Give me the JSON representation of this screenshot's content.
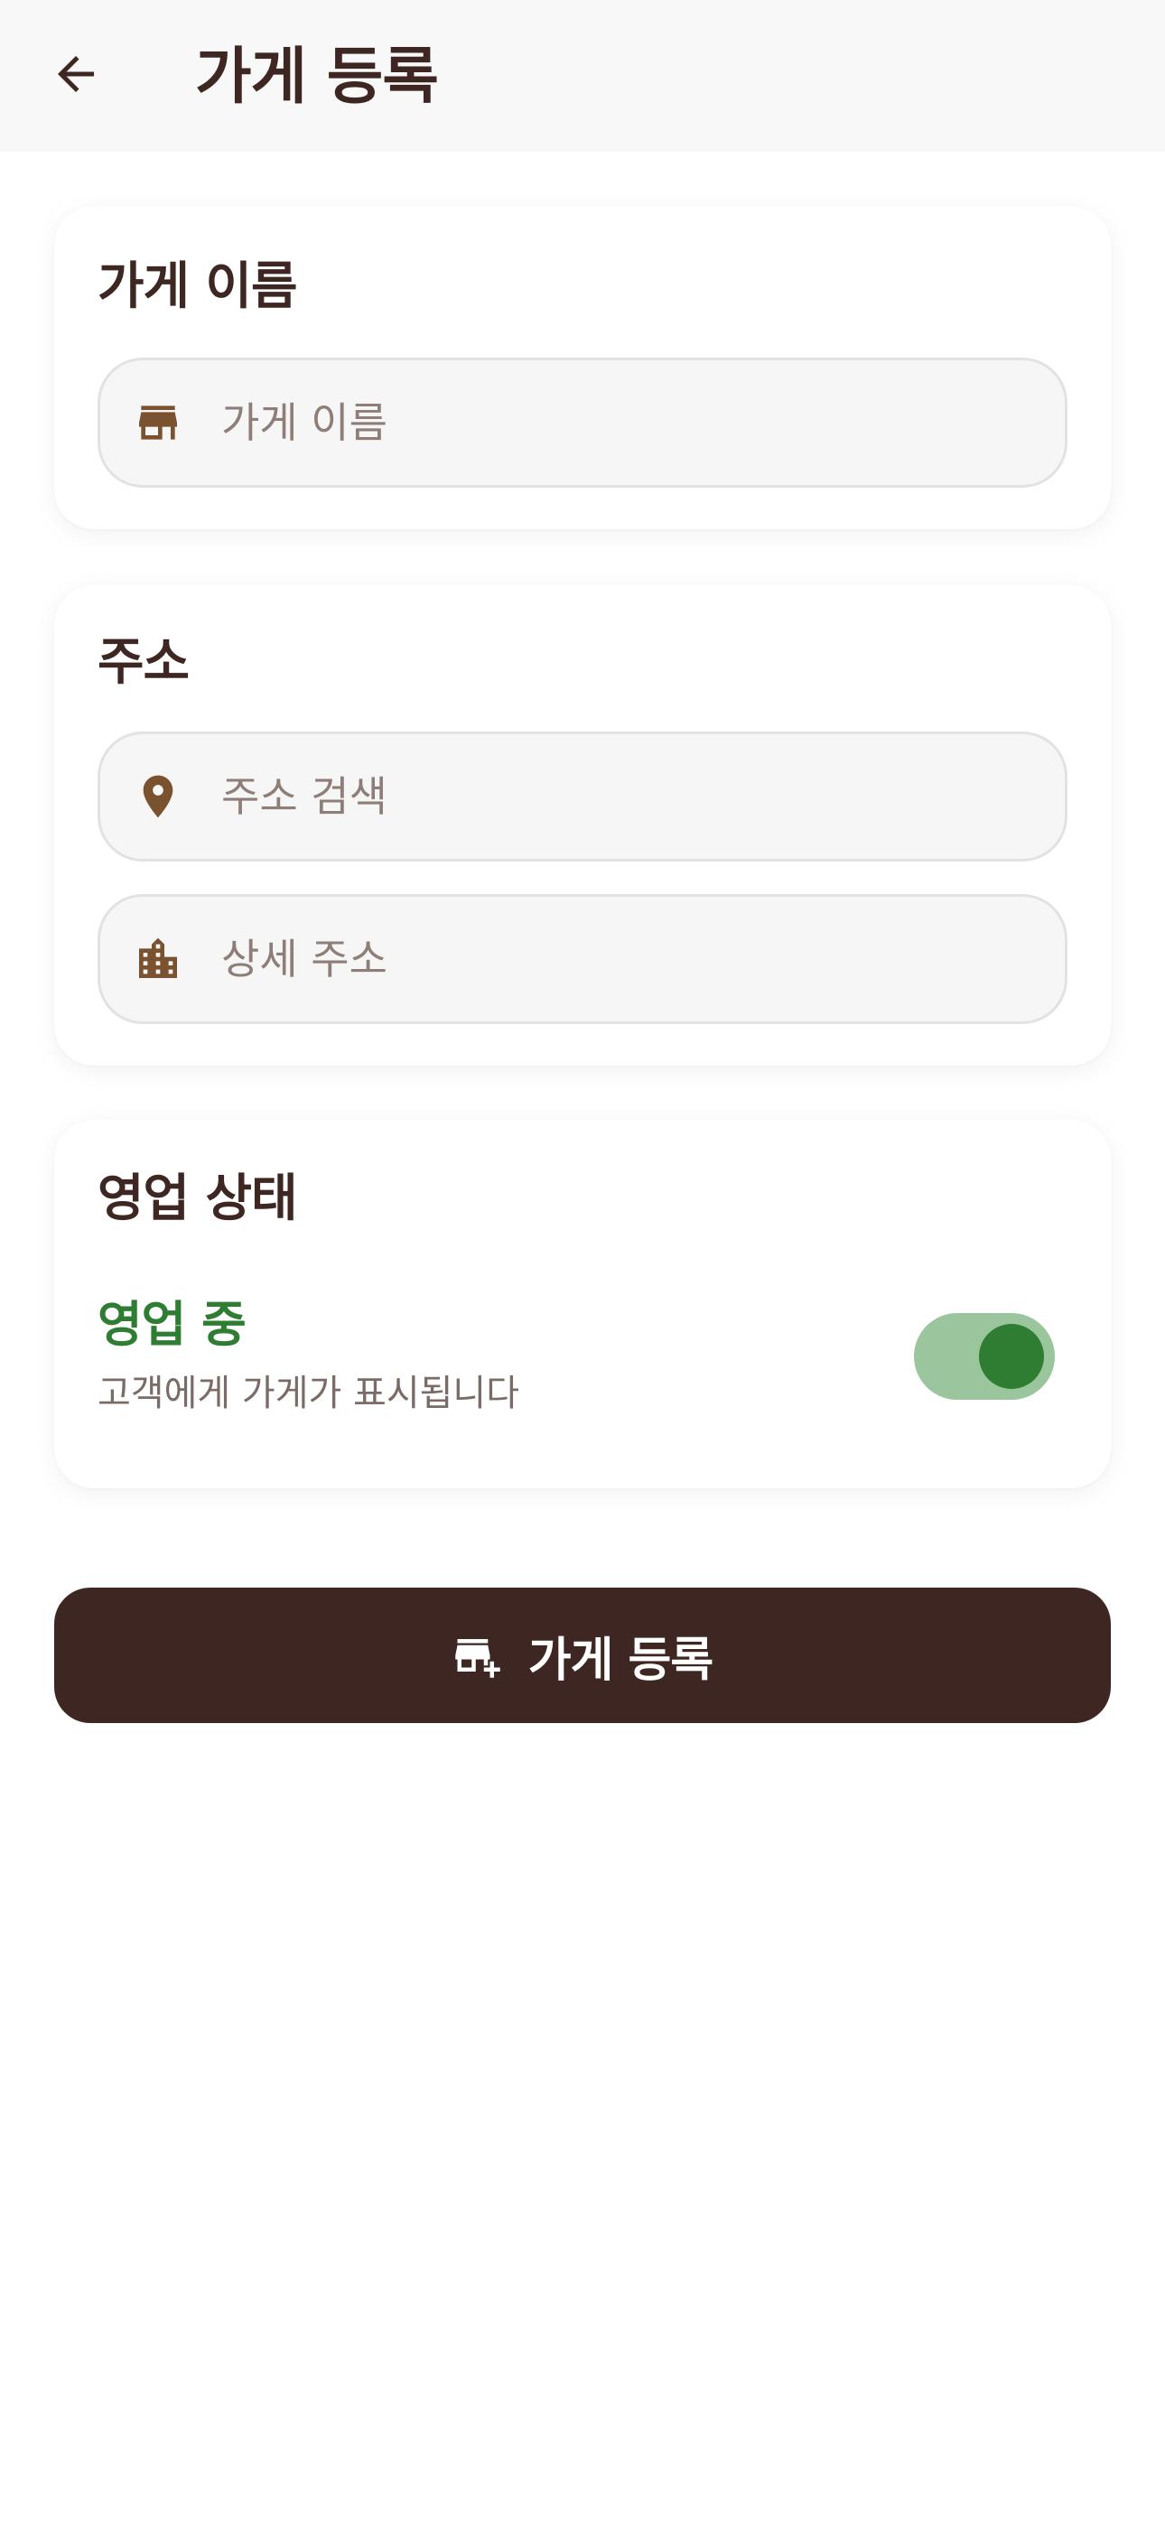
{
  "appbar": {
    "title": "가게 등록",
    "back_icon": "arrow-back-icon"
  },
  "store_name_card": {
    "title": "가게 이름",
    "field": {
      "placeholder": "가게 이름",
      "value": "",
      "icon": "storefront-icon"
    }
  },
  "address_card": {
    "title": "주소",
    "search_field": {
      "placeholder": "주소 검색",
      "value": "",
      "icon": "location-pin-icon"
    },
    "detail_field": {
      "placeholder": "상세 주소",
      "value": "",
      "icon": "building-icon"
    }
  },
  "status_card": {
    "title": "영업 상태",
    "status_label": "영업 중",
    "status_description": "고객에게 가게가 표시됩니다",
    "toggle_on": true
  },
  "submit": {
    "label": "가게 등록",
    "icon": "add-business-icon"
  },
  "colors": {
    "primary": "#3e2723",
    "accent_brown": "#7b5230",
    "active_green": "#2e7d32",
    "toggle_track": "#9bc59c",
    "field_bg": "#f6f6f6",
    "placeholder": "#8f7d78"
  }
}
